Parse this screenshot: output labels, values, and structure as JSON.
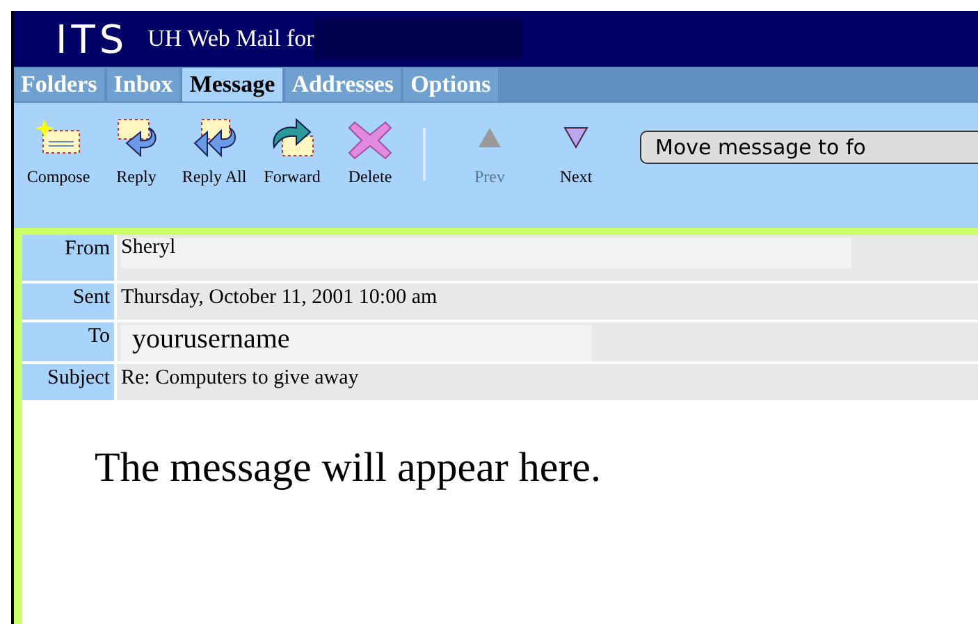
{
  "header": {
    "logo": "ITS",
    "title": "UH Web Mail for"
  },
  "tabs": [
    {
      "label": "Folders",
      "selected": false
    },
    {
      "label": "Inbox",
      "selected": false
    },
    {
      "label": "Message",
      "selected": true
    },
    {
      "label": "Addresses",
      "selected": false
    },
    {
      "label": "Options",
      "selected": false
    }
  ],
  "toolbar": [
    {
      "kind": "compose",
      "label": "Compose",
      "disabled": false
    },
    {
      "kind": "reply",
      "label": "Reply",
      "disabled": false
    },
    {
      "kind": "replyall",
      "label": "Reply All",
      "disabled": false
    },
    {
      "kind": "forward",
      "label": "Forward",
      "disabled": false
    },
    {
      "kind": "delete",
      "label": "Delete",
      "disabled": false
    },
    {
      "kind": "separator"
    },
    {
      "kind": "prev",
      "label": "Prev",
      "disabled": true
    },
    {
      "kind": "next",
      "label": "Next",
      "disabled": false
    }
  ],
  "move_button": "Move message to fo",
  "fields": [
    {
      "label": "From",
      "value": "Sheryl",
      "kind": "boxed"
    },
    {
      "label": "Sent",
      "value": "Thursday, October 11, 2001 10:00 am",
      "kind": "plain"
    },
    {
      "label": "To",
      "value": "yourusername",
      "kind": "input"
    },
    {
      "label": "Subject",
      "value": "Re: Computers to give away",
      "kind": "plain"
    }
  ],
  "body": "The message will appear here."
}
